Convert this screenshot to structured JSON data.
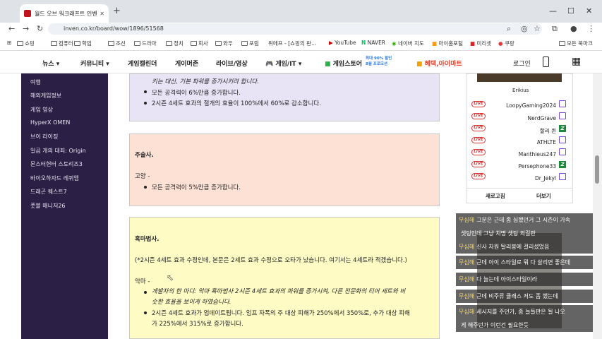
{
  "browser": {
    "tab_title": "월드 오브 워크래프트 인벤 : 인",
    "url": "inven.co.kr/board/wow/1896/51568"
  },
  "bookmarks": [
    "쇼핑",
    "컴퓨터",
    "학업",
    "조선",
    "드라마",
    "정치",
    "회사",
    "와우",
    "포럼",
    "위메프 - [쇼핑의 판...",
    "YouTube",
    "NAVER",
    "네이버 지도",
    "마이홈포털",
    "미리셋",
    "쿠팡",
    "모든 북마크"
  ],
  "nav": {
    "items": [
      "뉴스 ▾",
      "커뮤니티 ▾",
      "게임캘린더",
      "게이머존",
      "라이브/영상",
      "게임/IT ▾",
      "게임스토어",
      "혜택,아이마트",
      "로그인"
    ],
    "badge": "최대 90% 할인 8월 프로모션"
  },
  "sidebar": {
    "items": [
      "여행",
      "해외게임정보",
      "게임 영상",
      "HyperX OMEN",
      "브이 라이징",
      "일곱 개의 대죄: Origin",
      "몬스터헌터 스토리즈3",
      "바이오하자드 레퀴엠",
      "드래곤 퀘스트7",
      "풋볼 매니저26"
    ]
  },
  "post": {
    "b1": {
      "l1": "키는 대신, 기본 파워를 증가시키려 합니다.",
      "l2": "모든 공격력이 6%만큼 증가합니다.",
      "l3": "2시즌 4세트 효과의 절개의 효율이 100%에서 60%로 감소합니다."
    },
    "b2": {
      "title": "주술사.",
      "spec": "고양 -",
      "l1": "모든 공격력이 5%만큼 증가합니다."
    },
    "b3": {
      "title": "흑마법사.",
      "note": "(*2시즌 4세트 효과 수정인데, 본문은 2세트 효과 수정으로 오타가 났습니다. 여기서는 4세트라 적겠습니다.)",
      "spec": "악마 -",
      "l1a": "개발자의 한 마디: 악마 흑마법사 2시즌 4세트 효과의 파워를 증가시켜, 다른 전문화의 티어 세트와 비",
      "l1b": "슷한 효율을 보이게 하였습니다.",
      "l2a": "2시즌 4세트 효과가 업데이트됩니다. 임프 자폭의 주 대상 피해가 250%에서 350%로, 추가 대상 피해",
      "l2b": "가 225%에서 315%로 증가합니다."
    }
  },
  "streams": {
    "top": "Erikius",
    "list": [
      {
        "n": "LoopyGaming2024",
        "p": "twitch"
      },
      {
        "n": "NerdGrave",
        "p": "twitch"
      },
      {
        "n": "할리 퀸",
        "p": "chzzk"
      },
      {
        "n": "ATHLTE",
        "p": "twitch"
      },
      {
        "n": "Manthieus247",
        "p": "twitch"
      },
      {
        "n": "Persephone33",
        "p": "chzzk"
      },
      {
        "n": "Dr_Jekyl",
        "p": "twitch"
      }
    ],
    "live": "LIVE",
    "refresh": "새로고침",
    "more": "더보기"
  },
  "chat": [
    {
      "n": "무심해",
      "m": "그분은 근데 좀 심했던거 그 시즌이 가속"
    },
    {
      "n": "",
      "m": "셋팅인데 그냥 치명 셋팅 외길판"
    },
    {
      "n": "무심해",
      "m": "신사 차원 탈리붕에 걸리셨었음"
    },
    {
      "n": "무심해",
      "m": "근데 아이 스타일로 뭐 다 살리면 좋은데"
    },
    {
      "n": "무심해",
      "m": "다 늘는데 아이스타일이라"
    },
    {
      "n": "무심해",
      "m": "근데 비주류 클래스 저도 좀 했는데"
    },
    {
      "n": "무심해",
      "m": "세시지를 주던가, 좀 늘들판은 될 나오"
    },
    {
      "n": "",
      "m": "게 해주던가 이런건 필요한듯"
    }
  ]
}
